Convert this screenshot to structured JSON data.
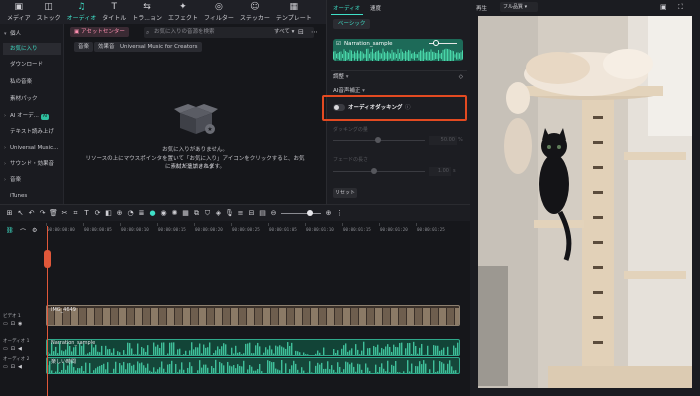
{
  "toolbar": {
    "items": [
      {
        "label": "メディア",
        "icon": "media-icon"
      },
      {
        "label": "ストック",
        "icon": "stock-icon"
      },
      {
        "label": "オーディオ",
        "icon": "music-note-icon"
      },
      {
        "label": "タイトル",
        "icon": "title-icon"
      },
      {
        "label": "トラ...ョン",
        "icon": "transition-icon"
      },
      {
        "label": "エフェクト",
        "icon": "effect-icon"
      },
      {
        "label": "フィルター",
        "icon": "filter-icon"
      },
      {
        "label": "ステッカー",
        "icon": "sticker-icon"
      },
      {
        "label": "テンプレート",
        "icon": "template-icon"
      }
    ],
    "active_index": 2
  },
  "sidebar": {
    "items": [
      {
        "label": "個人",
        "selected": false,
        "chevron": "▾"
      },
      {
        "label": "お気に入り",
        "selected": true
      },
      {
        "label": "ダウンロード",
        "selected": false
      },
      {
        "label": "私の音楽",
        "selected": false
      },
      {
        "label": "素材パック",
        "selected": false
      },
      {
        "label": "AI オーデ...",
        "selected": false,
        "chevron": "›",
        "badge": "AI"
      },
      {
        "label": "テキスト読み上げ",
        "selected": false
      },
      {
        "label": "Universal Music...",
        "selected": false,
        "chevron": "›"
      },
      {
        "label": "サウンド・効果音",
        "selected": false,
        "chevron": "›"
      },
      {
        "label": "音楽",
        "selected": false,
        "chevron": "›"
      },
      {
        "label": "iTunes",
        "selected": false
      }
    ]
  },
  "media": {
    "asset_center": "アセットセンター",
    "search_placeholder": "お気に入りの音源を検索",
    "sort_label": "すべて",
    "filter_tabs": [
      "音楽",
      "効果音",
      "Universal Music for Creators"
    ],
    "empty_line1": "お気に入りがありません。",
    "empty_line2": "リソースの上にマウスポインタを置いて「お気に入り」アイコンをクリックすると、お気に入りフォルダ",
    "empty_line3": "に素材が追加されます。"
  },
  "properties": {
    "tabs": [
      "オーディオ",
      "速度"
    ],
    "active_tab": 0,
    "basic_label": "ベーシック",
    "clip_name": "Narration_sample",
    "adjust_label": "調整",
    "ai_label": "AI音声補正",
    "ducking_label": "オーディオダッキング",
    "ducking_level_label": "ダッキングの量",
    "ducking_level_value": "50.00",
    "ducking_level_unit": "%",
    "fade_label": "フェードの長さ",
    "fade_value": "1.00",
    "fade_unit": "s",
    "reset_label": "リセット",
    "highlight_color": "#e34a21"
  },
  "preview": {
    "label": "再生",
    "quality": "フル品質"
  },
  "timeline": {
    "ruler_ticks": [
      "00:00:00:00",
      "00:00:00:05",
      "00:00:00:10",
      "00:00:00:15",
      "00:00:00:20",
      "00:00:00:25",
      "00:00:01:05",
      "00:00:01:10",
      "00:00:01:15",
      "00:00:01:20",
      "00:00:01:25"
    ],
    "tracks": [
      {
        "name": "ビデオ 1",
        "clip": "IMG_4649"
      },
      {
        "name": "オーディオ 1",
        "clip": "Narration_sample"
      },
      {
        "name": "オーディオ 2",
        "clip": "楽しい時間"
      }
    ],
    "accent": "#3fe0c8",
    "playhead_color": "#e0583a"
  }
}
